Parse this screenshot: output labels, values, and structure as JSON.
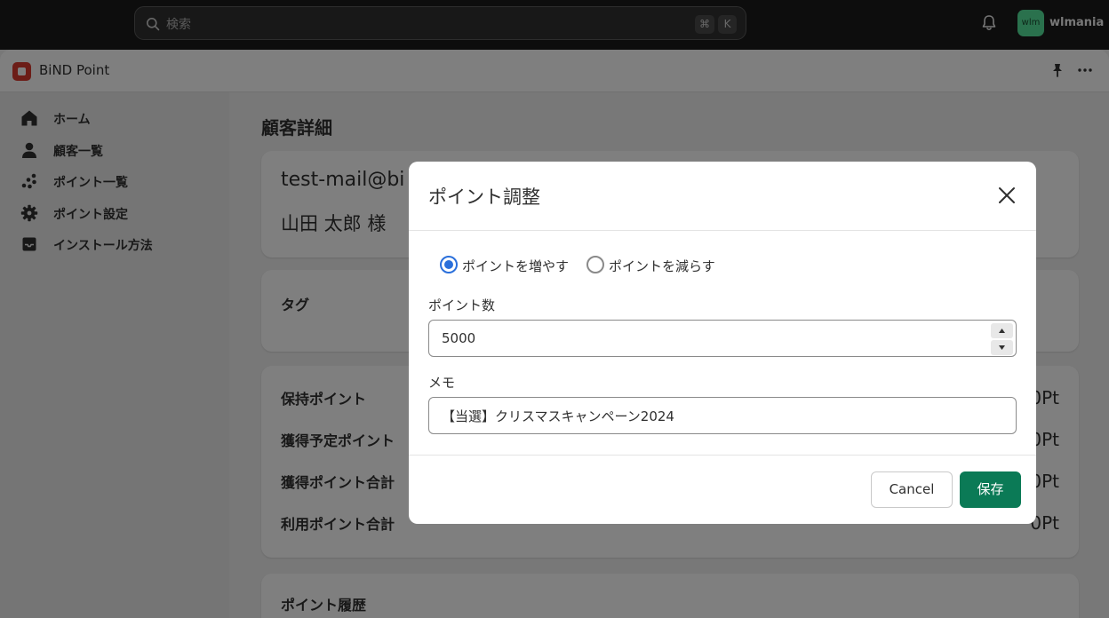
{
  "topbar": {
    "search_placeholder": "検索",
    "shortcut_keys": [
      "⌘",
      "K"
    ],
    "avatar_initials": "wlm",
    "username": "wlmania"
  },
  "app": {
    "name": "BiND Point"
  },
  "sidebar": {
    "items": [
      {
        "label": "ホーム",
        "icon": "home-icon"
      },
      {
        "label": "顧客一覧",
        "icon": "person-icon"
      },
      {
        "label": "ポイント一覧",
        "icon": "points-icon"
      },
      {
        "label": "ポイント設定",
        "icon": "gear-icon"
      },
      {
        "label": "インストール方法",
        "icon": "inbox-icon"
      }
    ]
  },
  "main": {
    "title": "顧客詳細",
    "customer": {
      "email": "test-mail@bi",
      "name": "山田 太郎 様"
    },
    "tag_label": "タグ",
    "stats": [
      {
        "label": "保持ポイント",
        "value": "0Pt"
      },
      {
        "label": "獲得予定ポイント",
        "value": "0Pt"
      },
      {
        "label": "獲得ポイント合計",
        "value": "0Pt"
      },
      {
        "label": "利用ポイント合計",
        "value": "0Pt"
      }
    ],
    "history_label": "ポイント履歴"
  },
  "modal": {
    "title": "ポイント調整",
    "radio_increase": "ポイントを増やす",
    "radio_decrease": "ポイントを減らす",
    "selected": "increase",
    "points_label": "ポイント数",
    "points_value": "5000",
    "memo_label": "メモ",
    "memo_value": "【当選】クリスマスキャンペーン2024",
    "cancel_label": "Cancel",
    "save_label": "保存"
  },
  "colors": {
    "accent_primary": "#0b7a56",
    "radio_selected": "#2a6fdb",
    "topbar_bg": "#1a1a1a",
    "avatar_bg": "#54e39a",
    "logo": "#d83a2f"
  }
}
